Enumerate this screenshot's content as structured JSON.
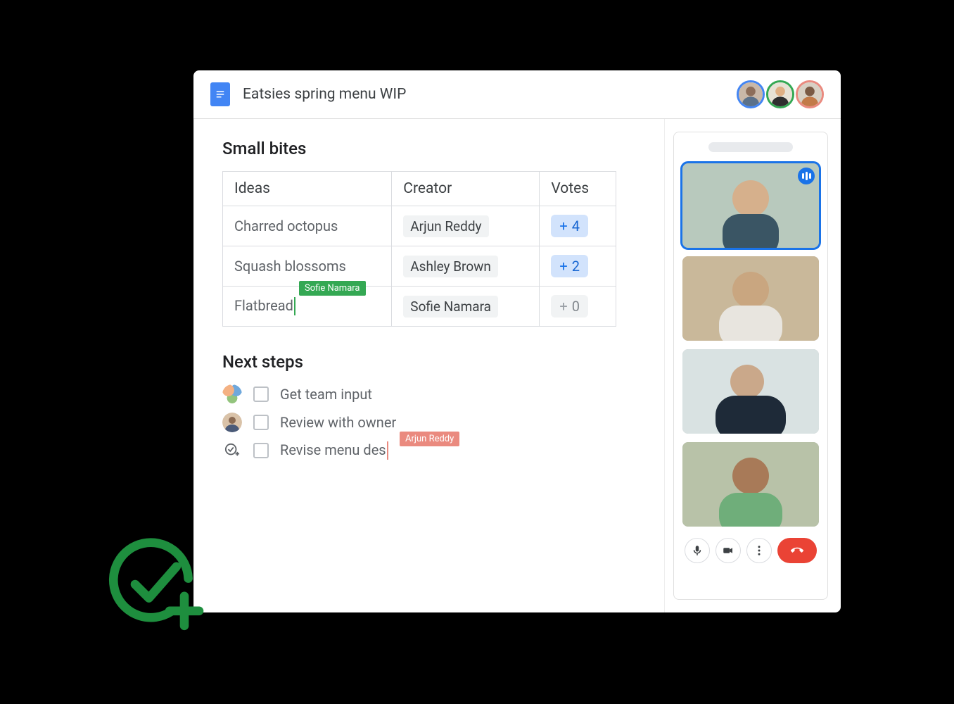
{
  "header": {
    "doc_title": "Eatsies spring menu WIP",
    "collaborators": [
      {
        "name": "Collaborator 1",
        "ring_color": "#4285F4"
      },
      {
        "name": "Collaborator 2",
        "ring_color": "#34A853"
      },
      {
        "name": "Collaborator 3",
        "ring_color": "#EA8A7F"
      }
    ]
  },
  "content": {
    "section1_heading": "Small bites",
    "table": {
      "columns": [
        "Ideas",
        "Creator",
        "Votes"
      ],
      "rows": [
        {
          "idea": "Charred octopus",
          "creator": "Arjun Reddy",
          "votes": 4,
          "votes_display": "+ 4",
          "vote_style": "pos"
        },
        {
          "idea": "Squash blossoms",
          "creator": "Ashley Brown",
          "votes": 2,
          "votes_display": "+ 2",
          "vote_style": "pos"
        },
        {
          "idea": "Flatbread",
          "creator": "Sofie Namara",
          "votes": 0,
          "votes_display": "+ 0",
          "vote_style": "zero",
          "live_cursor": {
            "label": "Sofie Namara",
            "color": "green"
          }
        }
      ]
    },
    "section2_heading": "Next steps",
    "tasks": [
      {
        "text": "Get team input",
        "assignee_kind": "multi"
      },
      {
        "text": "Review with owner",
        "assignee_kind": "single"
      },
      {
        "text": "Revise menu des",
        "assignee_kind": "addtask",
        "live_cursor": {
          "label": "Arjun Reddy",
          "color": "red"
        }
      }
    ]
  },
  "meet": {
    "participants": [
      {
        "speaking": true
      },
      {
        "speaking": false
      },
      {
        "speaking": false
      },
      {
        "speaking": false
      }
    ],
    "controls": {
      "mic": "mic-icon",
      "camera": "camera-icon",
      "more": "more-icon",
      "hangup": "hangup-icon"
    }
  },
  "colors": {
    "blue": "#4285F4",
    "green": "#34A853",
    "red": "#EA4335",
    "salmon": "#EA8A7F",
    "vote_bg": "#d2e3fc",
    "grey_chip": "#f1f3f4"
  }
}
